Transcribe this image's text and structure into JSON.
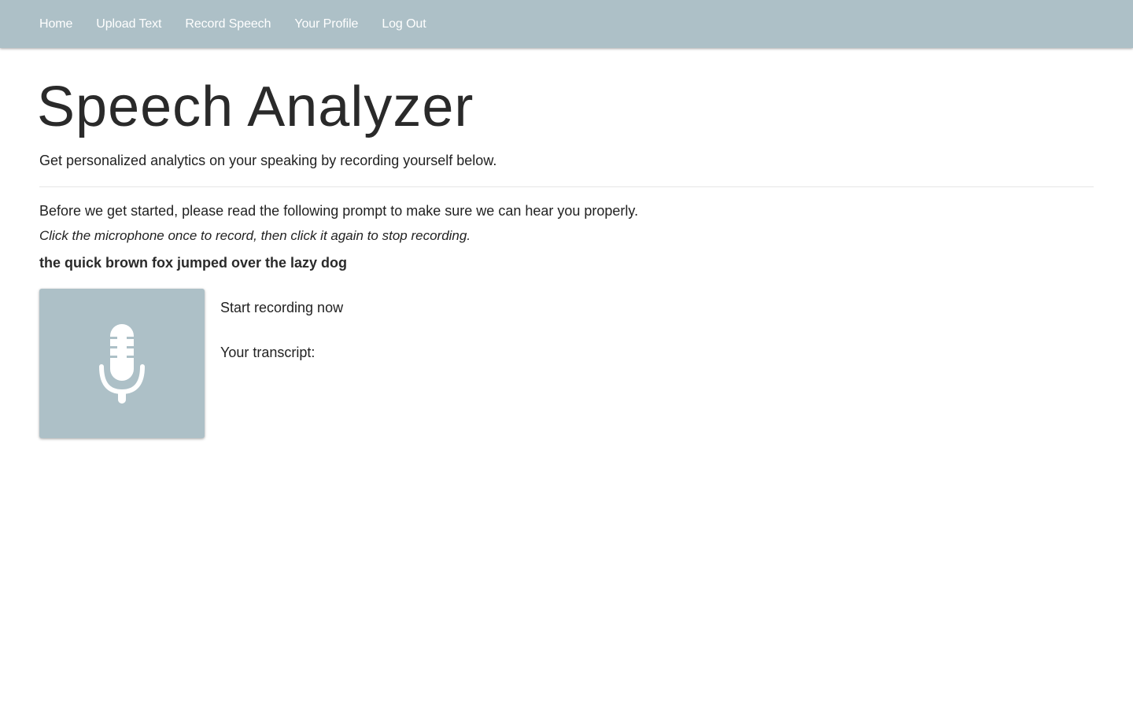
{
  "nav": {
    "items": [
      {
        "label": "Home"
      },
      {
        "label": "Upload Text"
      },
      {
        "label": "Record Speech"
      },
      {
        "label": "Your Profile"
      },
      {
        "label": "Log Out"
      }
    ]
  },
  "header": {
    "title": "Speech Analyzer",
    "subtitle": "Get personalized analytics on your speaking by recording yourself below."
  },
  "main": {
    "intro": "Before we get started, please read the following prompt to make sure we can hear you properly.",
    "instruction": "Click the microphone once to record, then click it again to stop recording.",
    "prompt": "the quick brown fox jumped over the lazy dog",
    "mic": {
      "icon": "microphone-icon"
    },
    "status": "Start recording now",
    "transcript_label": "Your transcript:",
    "transcript_value": ""
  },
  "colors": {
    "navbar": "#adc0c7",
    "mic_button": "#adc0c7",
    "icon": "#ffffff",
    "text": "#222222"
  }
}
